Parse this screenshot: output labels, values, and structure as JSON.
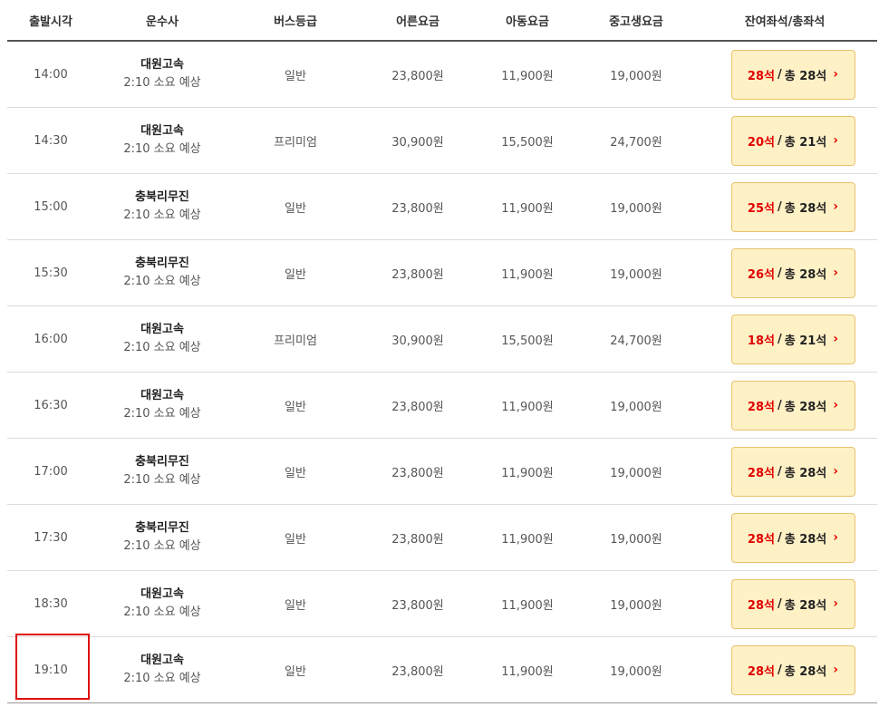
{
  "headers": {
    "departure": "출발시각",
    "company": "운수사",
    "grade": "버스등급",
    "adult": "어른요금",
    "child": "아동요금",
    "student": "중고생요금",
    "seats": "잔여좌석/총좌석"
  },
  "rows": [
    {
      "time": "14:00",
      "company": "대원고속",
      "duration": "2:10 소요 예상",
      "grade": "일반",
      "adult": "23,800원",
      "child": "11,900원",
      "student": "19,000원",
      "remaining": "28석",
      "total": "총 28석"
    },
    {
      "time": "14:30",
      "company": "대원고속",
      "duration": "2:10 소요 예상",
      "grade": "프리미엄",
      "adult": "30,900원",
      "child": "15,500원",
      "student": "24,700원",
      "remaining": "20석",
      "total": "총 21석"
    },
    {
      "time": "15:00",
      "company": "충북리무진",
      "duration": "2:10 소요 예상",
      "grade": "일반",
      "adult": "23,800원",
      "child": "11,900원",
      "student": "19,000원",
      "remaining": "25석",
      "total": "총 28석"
    },
    {
      "time": "15:30",
      "company": "충북리무진",
      "duration": "2:10 소요 예상",
      "grade": "일반",
      "adult": "23,800원",
      "child": "11,900원",
      "student": "19,000원",
      "remaining": "26석",
      "total": "총 28석"
    },
    {
      "time": "16:00",
      "company": "대원고속",
      "duration": "2:10 소요 예상",
      "grade": "프리미엄",
      "adult": "30,900원",
      "child": "15,500원",
      "student": "24,700원",
      "remaining": "18석",
      "total": "총 21석"
    },
    {
      "time": "16:30",
      "company": "대원고속",
      "duration": "2:10 소요 예상",
      "grade": "일반",
      "adult": "23,800원",
      "child": "11,900원",
      "student": "19,000원",
      "remaining": "28석",
      "total": "총 28석"
    },
    {
      "time": "17:00",
      "company": "충북리무진",
      "duration": "2:10 소요 예상",
      "grade": "일반",
      "adult": "23,800원",
      "child": "11,900원",
      "student": "19,000원",
      "remaining": "28석",
      "total": "총 28석"
    },
    {
      "time": "17:30",
      "company": "충북리무진",
      "duration": "2:10 소요 예상",
      "grade": "일반",
      "adult": "23,800원",
      "child": "11,900원",
      "student": "19,000원",
      "remaining": "28석",
      "total": "총 28석"
    },
    {
      "time": "18:30",
      "company": "대원고속",
      "duration": "2:10 소요 예상",
      "grade": "일반",
      "adult": "23,800원",
      "child": "11,900원",
      "student": "19,000원",
      "remaining": "28석",
      "total": "총 28석"
    },
    {
      "time": "19:10",
      "company": "대원고속",
      "duration": "2:10 소요 예상",
      "grade": "일반",
      "adult": "23,800원",
      "child": "11,900원",
      "student": "19,000원",
      "remaining": "28석",
      "total": "총 28석"
    }
  ],
  "seat_separator": "/",
  "chevron_icon": "chevron-right-icon",
  "colors": {
    "seat_button_bg": "#fff1c6",
    "seat_button_border": "#e8c26b",
    "remaining_text": "#e00000",
    "highlight_border": "#e01010"
  }
}
